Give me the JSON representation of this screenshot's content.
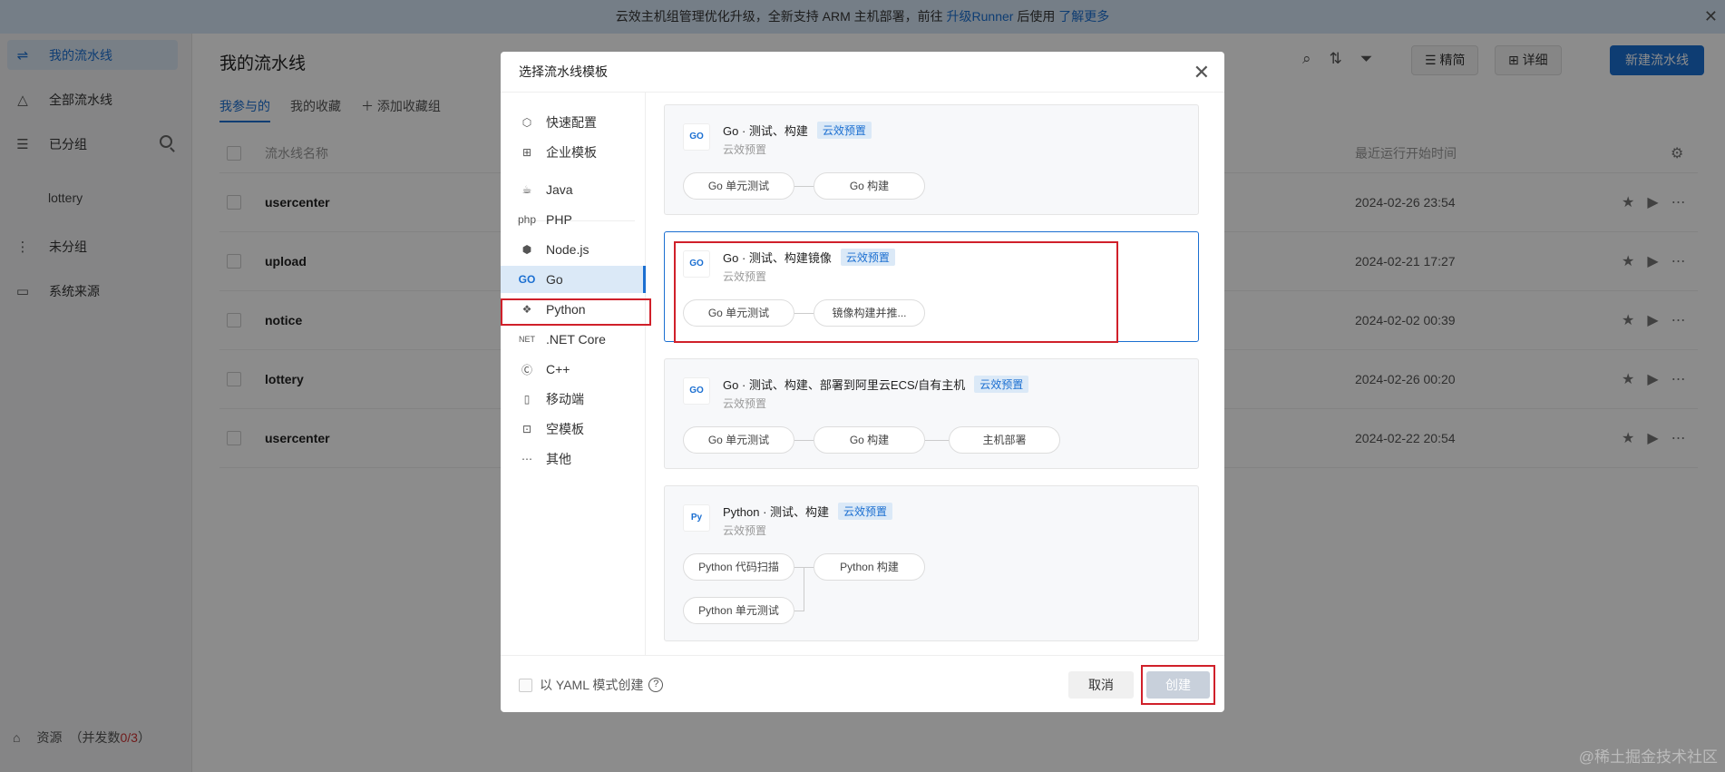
{
  "banner": {
    "text": "云效主机组管理优化升级，全新支持 ARM 主机部署，前往",
    "link1": "升级Runner",
    "mid": "后使用",
    "link2": "了解更多",
    "close": "✕"
  },
  "sidebar": {
    "items": [
      {
        "label": "我的流水线",
        "icon": "pipeline-icon"
      },
      {
        "label": "全部流水线",
        "icon": "triangle-icon"
      },
      {
        "label": "已分组",
        "icon": "list-icon"
      },
      {
        "label": "未分组",
        "icon": "ungroup-icon"
      },
      {
        "label": "系统来源",
        "icon": "monitor-icon"
      }
    ],
    "group_child": "lottery",
    "resource": {
      "label": "资源",
      "paren_open": "（并发数",
      "count": "0/3",
      "paren_close": "）"
    }
  },
  "main": {
    "title": "我的流水线",
    "tabs": [
      "我参与的",
      "我的收藏",
      "添加收藏组"
    ],
    "view_buttons": [
      "精简",
      "详细"
    ],
    "new_button": "新建流水线",
    "columns": {
      "name": "流水线名称",
      "time": "最近运行开始时间"
    },
    "rows": [
      {
        "name": "usercenter",
        "time": "2024-02-26 23:54"
      },
      {
        "name": "upload",
        "time": "2024-02-21 17:27"
      },
      {
        "name": "notice",
        "time": "2024-02-02 00:39"
      },
      {
        "name": "lottery",
        "time": "2024-02-26 00:20"
      },
      {
        "name": "usercenter",
        "time": "2024-02-22 20:54"
      }
    ]
  },
  "modal": {
    "title": "选择流水线模板",
    "close": "✕",
    "categories": [
      {
        "label": "快速配置",
        "icon": "cube-icon"
      },
      {
        "label": "企业模板",
        "icon": "grid-icon"
      },
      {
        "label": "Java",
        "icon": "java-icon"
      },
      {
        "label": "PHP",
        "icon": "php-icon",
        "glyph": "php"
      },
      {
        "label": "Node.js",
        "icon": "nodejs-icon"
      },
      {
        "label": "Go",
        "icon": "go-icon",
        "glyph": "GO"
      },
      {
        "label": "Python",
        "icon": "python-icon"
      },
      {
        "label": ".NET Core",
        "icon": "dotnet-icon",
        "glyph": "NET"
      },
      {
        "label": "C++",
        "icon": "cpp-icon"
      },
      {
        "label": "移动端",
        "icon": "mobile-icon"
      },
      {
        "label": "空模板",
        "icon": "blank-template-icon"
      },
      {
        "label": "其他",
        "icon": "more-icon"
      }
    ],
    "tag": "云效预置",
    "sub": "云效预置",
    "templates": [
      {
        "title": "Go · 测试、构建",
        "logo": "GO",
        "steps": [
          "Go 单元测试",
          "Go 构建"
        ]
      },
      {
        "title": "Go · 测试、构建镜像",
        "logo": "GO",
        "steps": [
          "Go 单元测试",
          "镜像构建并推..."
        ]
      },
      {
        "title": "Go · 测试、构建、部署到阿里云ECS/自有主机",
        "logo": "GO",
        "steps": [
          "Go 单元测试",
          "Go 构建",
          "主机部署"
        ]
      },
      {
        "title": "Python · 测试、构建",
        "logo": "Py",
        "steps": [
          "Python 代码扫描",
          "Python 构建",
          "Python 单元测试"
        ]
      }
    ],
    "yaml_label": "以 YAML 模式创建",
    "cancel": "取消",
    "create": "创建"
  },
  "watermark": "@稀土掘金技术社区",
  "colors": {
    "accent": "#1b6fd1",
    "highlight": "#d0202a"
  }
}
